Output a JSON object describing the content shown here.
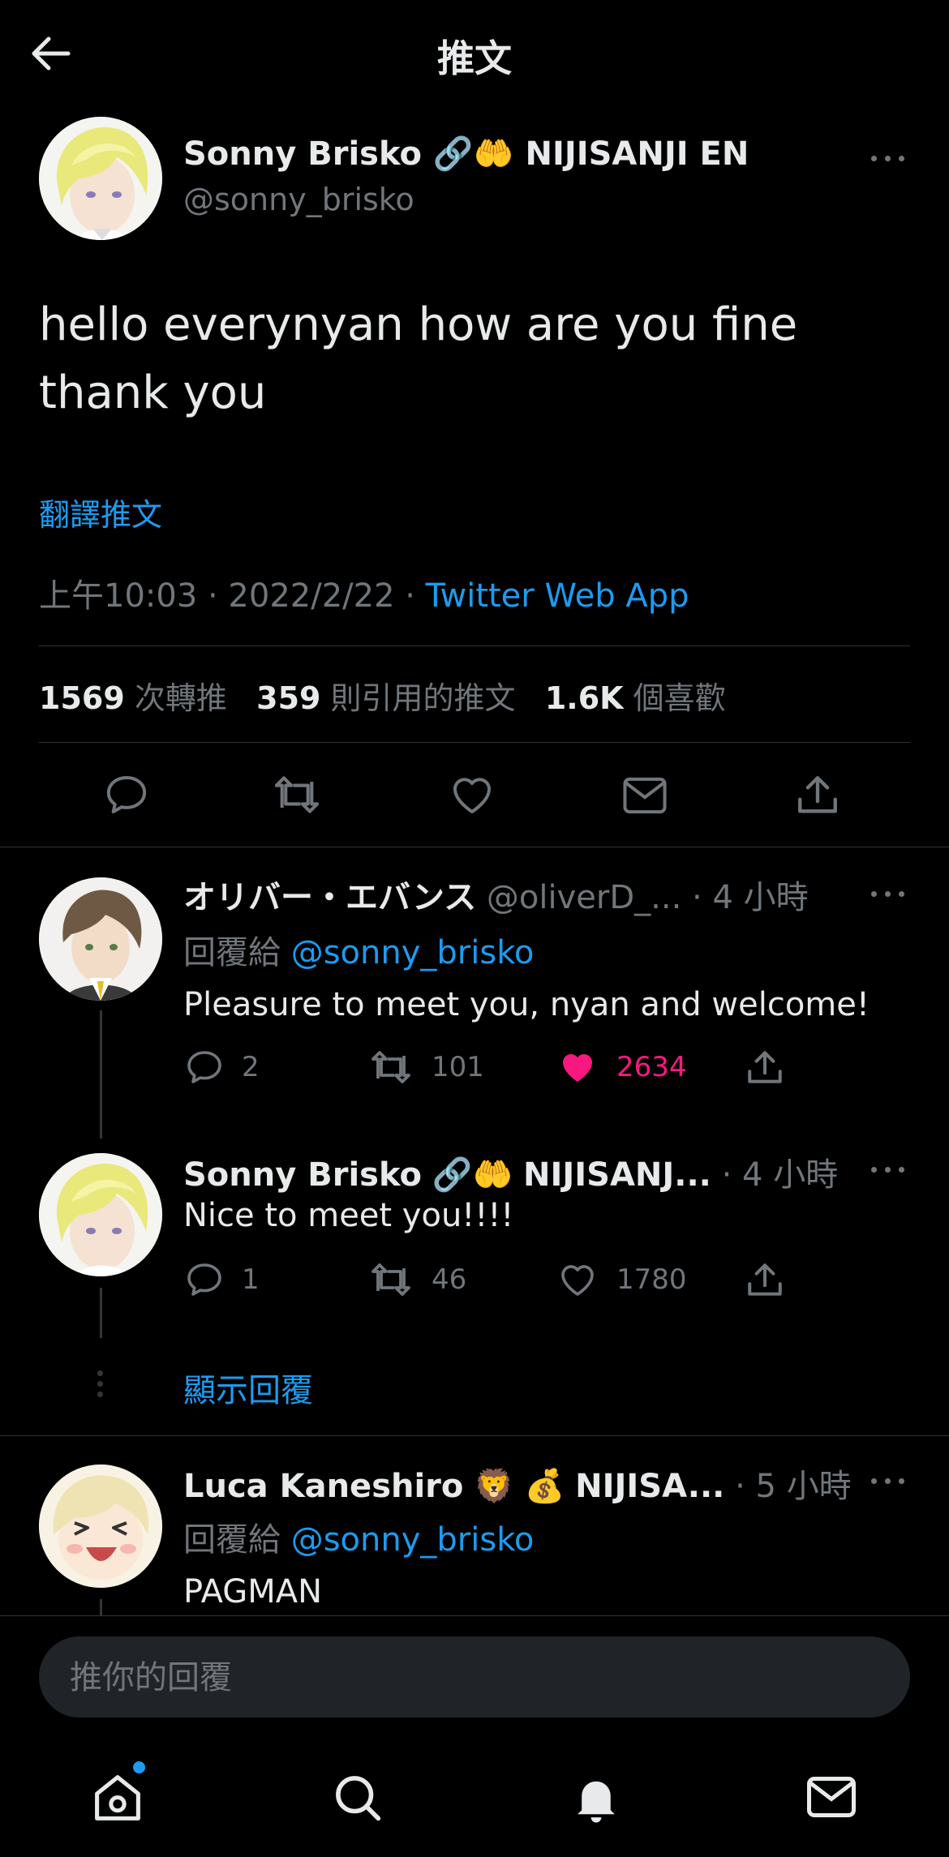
{
  "header": {
    "title": "推文"
  },
  "main_tweet": {
    "display_name": "Sonny Brisko",
    "emoji": "🔗🤲",
    "affiliation": "NIJISANJI EN",
    "handle": "@sonny_brisko",
    "text_line1": "hello everynyan how are you fine",
    "text_line2": "thank you",
    "translate": "翻譯推文",
    "timestamp": "上午10:03 · 2022/2/22 · ",
    "source": "Twitter Web App",
    "retweets_count": "1569",
    "retweets_label": "次轉推",
    "quotes_count": "359",
    "quotes_label": "則引用的推文",
    "likes_count": "1.6K",
    "likes_label": "個喜歡"
  },
  "replies": [
    {
      "display_name": "オリバー・エバンス",
      "handle": "@oliverD_...",
      "time": "· 4 小時",
      "reply_to_label": "回覆給",
      "reply_to_handle": "@sonny_brisko",
      "text": "Pleasure to meet you, nyan and welcome!",
      "replies": "2",
      "retweets": "101",
      "likes": "2634",
      "liked": true
    },
    {
      "display_name": "Sonny Brisko",
      "emoji": "🔗🤲",
      "affiliation": "NIJISANJ...",
      "time": "· 4 小時",
      "text": "Nice to meet you!!!!",
      "replies": "1",
      "retweets": "46",
      "likes": "1780",
      "liked": false
    },
    {
      "display_name": "Luca Kaneshiro",
      "emoji": "🦁 💰",
      "affiliation": "NIJISA...",
      "time": "· 5 小時",
      "reply_to_label": "回覆給",
      "reply_to_handle": "@sonny_brisko",
      "text": "PAGMAN"
    }
  ],
  "show_replies": "顯示回覆",
  "composer": {
    "placeholder": "推你的回覆"
  },
  "colors": {
    "accent": "#1d9bf0",
    "like": "#f91880",
    "background": "#000000",
    "muted": "#71767b"
  },
  "bottom_nav": [
    "home-icon",
    "search-icon",
    "bell-icon",
    "mail-icon"
  ]
}
